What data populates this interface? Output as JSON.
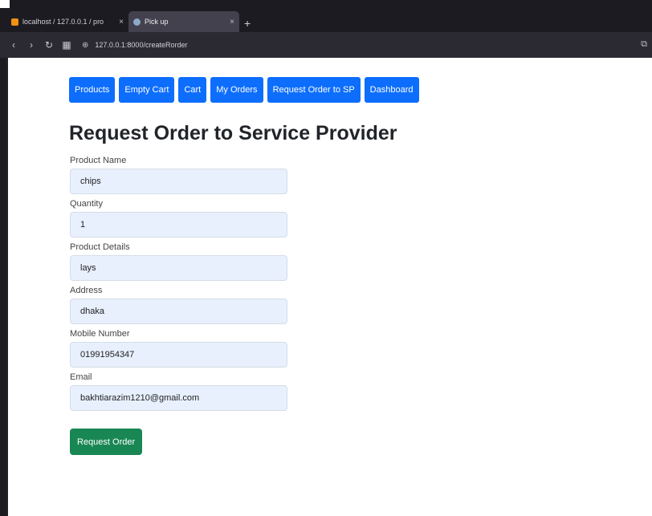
{
  "browser": {
    "tabs": [
      {
        "title": "localhost / 127.0.0.1 / pro",
        "active": false
      },
      {
        "title": "Pick up",
        "active": true
      }
    ],
    "url": "127.0.0.1:8000/createRorder"
  },
  "nav": {
    "items": [
      "Products",
      "Empty Cart",
      "Cart",
      "My Orders",
      "Request Order to SP",
      "Dashboard"
    ]
  },
  "page": {
    "title": "Request Order to Service Provider"
  },
  "form": {
    "fields": [
      {
        "label": "Product Name",
        "value": "chips"
      },
      {
        "label": "Quantity",
        "value": "1"
      },
      {
        "label": "Product Details",
        "value": "lays"
      },
      {
        "label": "Address",
        "value": "dhaka"
      },
      {
        "label": "Mobile Number",
        "value": "01991954347"
      },
      {
        "label": "Email",
        "value": "bakhtiarazim1210@gmail.com"
      }
    ],
    "submit_label": "Request Order"
  },
  "colors": {
    "primary": "#0d6efd",
    "success": "#198754",
    "input_bg": "#e8f0fe"
  }
}
